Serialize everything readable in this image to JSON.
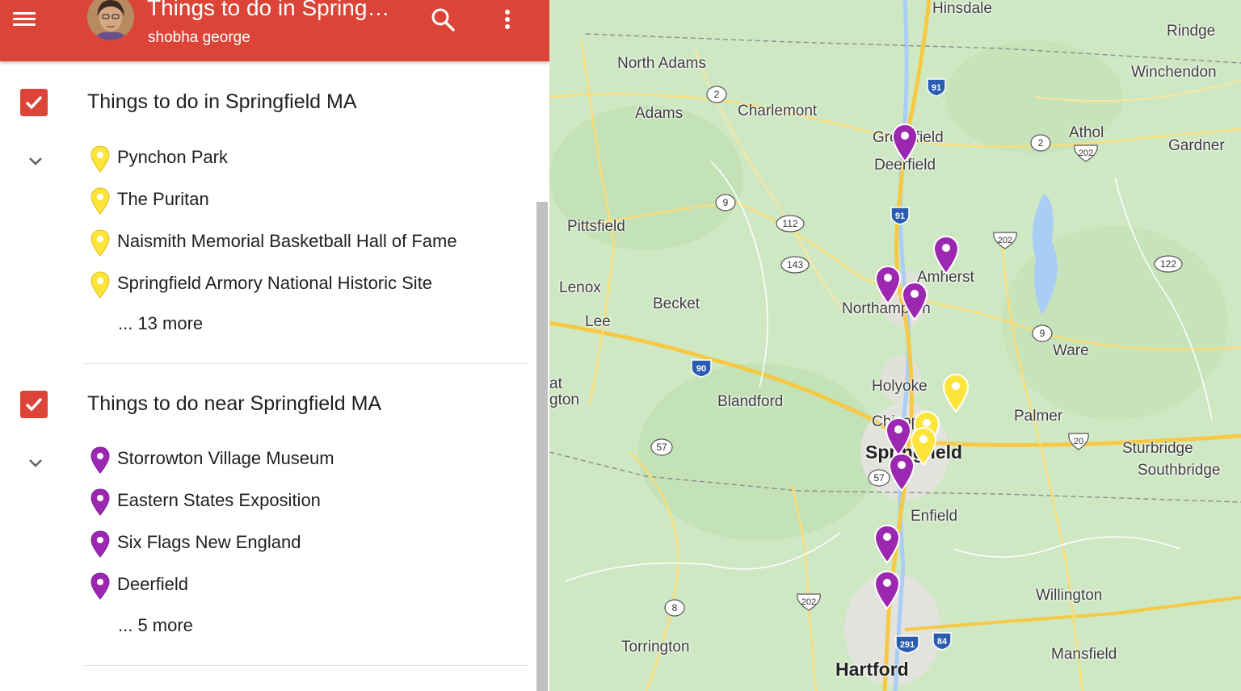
{
  "header": {
    "title": "Things to do in Spring…",
    "owner": "shobha george"
  },
  "layers": [
    {
      "title": "Things to do in Springfield MA",
      "color": "#fde43a",
      "items": [
        "Pynchon Park",
        "The Puritan",
        "Naismith Memorial Basketball Hall of Fame",
        "Springfield Armory National Historic Site"
      ],
      "more": "... 13 more"
    },
    {
      "title": "Things to do near Springfield MA",
      "color": "#9c27b0",
      "items": [
        "Storrowton Village Museum",
        "Eastern States Exposition",
        "Six Flags New England",
        "Deerfield"
      ],
      "more": "... 5 more"
    }
  ],
  "map": {
    "towns": {
      "hinsdale": "Hinsdale",
      "rindge": "Rindge",
      "north_adams": "North Adams",
      "winchendon": "Winchendon",
      "adams": "Adams",
      "charlemont": "Charlemont",
      "greenfield": "Greenfield",
      "athol": "Athol",
      "gardner": "Gardner",
      "deerfield": "Deerfield",
      "pittsfield": "Pittsfield",
      "amherst": "Amherst",
      "lenox": "Lenox",
      "becket": "Becket",
      "northampton": "Northampton",
      "lee": "Lee",
      "ware": "Ware",
      "holyoke": "Holyoke",
      "blandford": "Blandford",
      "palmer": "Palmer",
      "chicopee": "Chicopee",
      "springfield": "Springfield",
      "sturbridge": "Sturbridge",
      "southbridge": "Southbridge",
      "enfield": "Enfield",
      "willington": "Willington",
      "torrington": "Torrington",
      "mansfield": "Mansfield",
      "hartford": "Hartford",
      "edge_at": "at",
      "edge_gton": "gton"
    },
    "routes": {
      "r91": "91",
      "r2": "2",
      "r2b": "2",
      "r202": "202",
      "r9": "9",
      "r112": "112",
      "r143": "143",
      "r202b": "202",
      "r122": "122",
      "r9b": "9",
      "r90": "90",
      "r57": "57",
      "r57b": "57",
      "r20": "20",
      "r202c": "202",
      "r8": "8",
      "r291": "291",
      "r84": "84"
    }
  }
}
